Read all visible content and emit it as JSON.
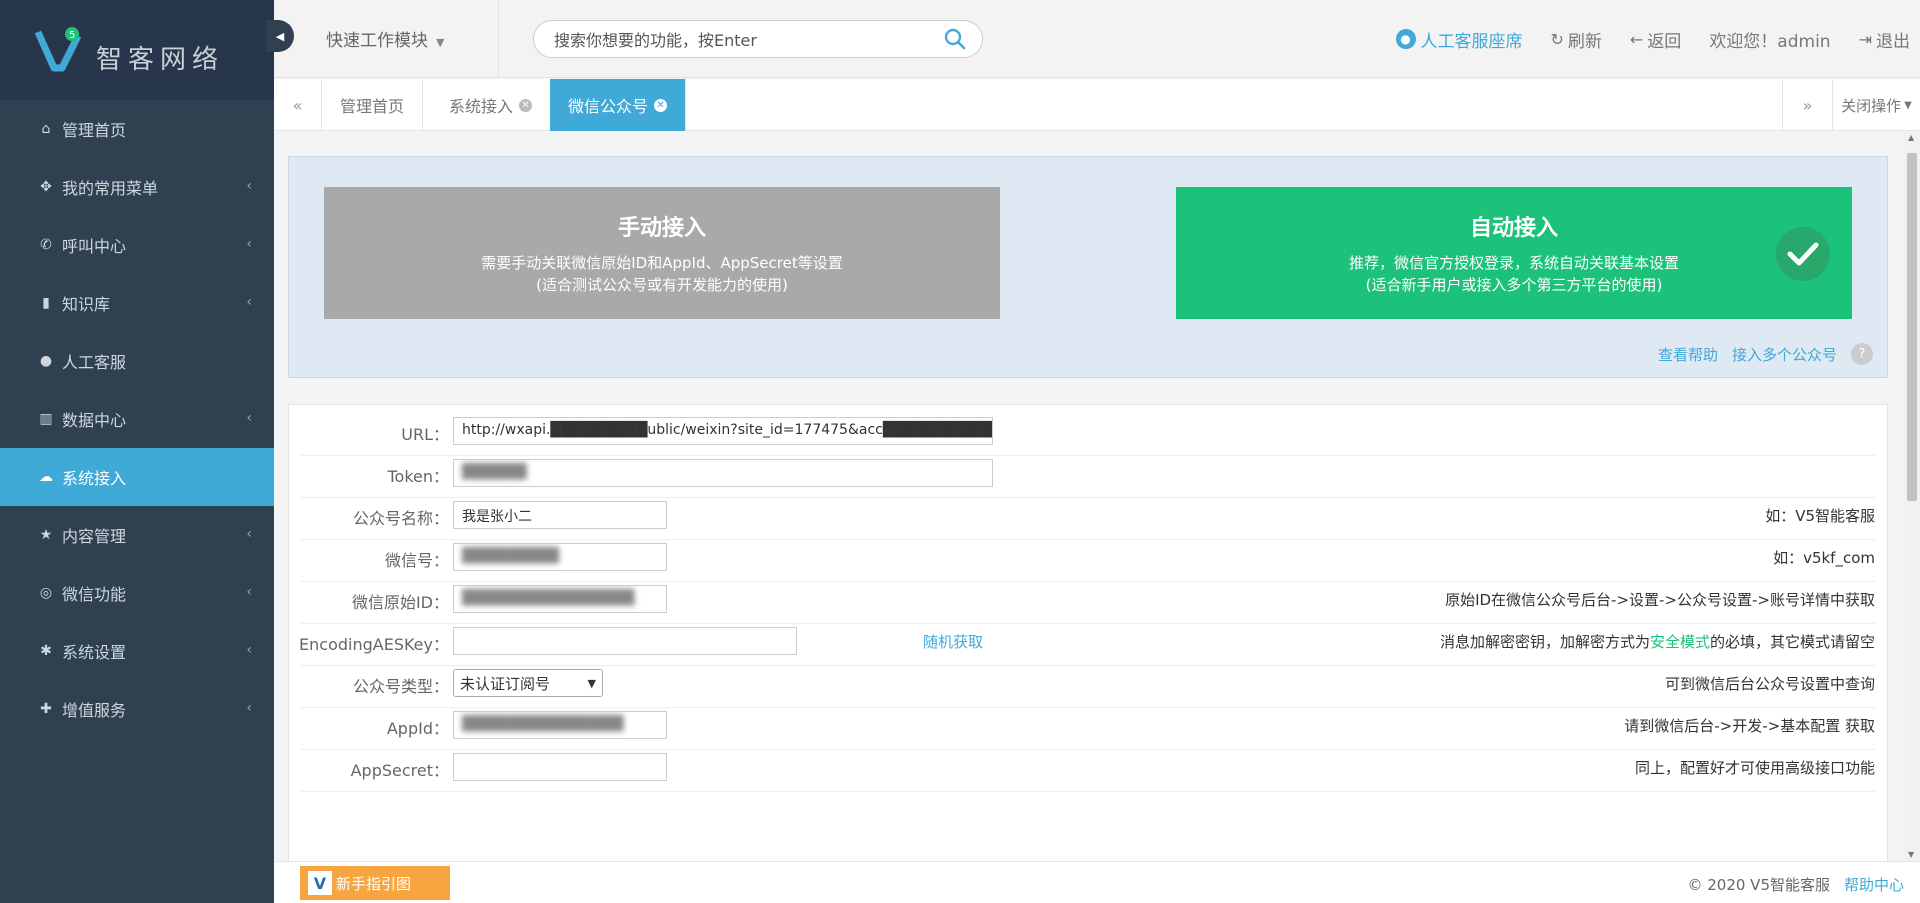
{
  "brand": {
    "logo_text": "智客网络"
  },
  "sidebar": {
    "items": [
      {
        "label": "管理首页",
        "icon": "home-icon",
        "glyph": "⌂",
        "has_submenu": false
      },
      {
        "label": "我的常用菜单",
        "icon": "grid-icon",
        "glyph": "✥",
        "has_submenu": true
      },
      {
        "label": "呼叫中心",
        "icon": "phone-icon",
        "glyph": "✆",
        "has_submenu": true
      },
      {
        "label": "知识库",
        "icon": "book-icon",
        "glyph": "▮",
        "has_submenu": true
      },
      {
        "label": "人工客服",
        "icon": "user-icon",
        "glyph": "●",
        "has_submenu": false
      },
      {
        "label": "数据中心",
        "icon": "bar-chart-icon",
        "glyph": "▥",
        "has_submenu": true
      },
      {
        "label": "系统接入",
        "icon": "cloud-icon",
        "glyph": "☁",
        "has_submenu": false,
        "active": true
      },
      {
        "label": "内容管理",
        "icon": "star-icon",
        "glyph": "★",
        "has_submenu": true
      },
      {
        "label": "微信功能",
        "icon": "wechat-icon",
        "glyph": "◎",
        "has_submenu": true
      },
      {
        "label": "系统设置",
        "icon": "gear-icon",
        "glyph": "✱",
        "has_submenu": true
      },
      {
        "label": "增值服务",
        "icon": "plus-icon",
        "glyph": "✚",
        "has_submenu": true
      }
    ]
  },
  "header": {
    "quick_module": "快速工作模块",
    "search_placeholder": "搜索你想要的功能，按Enter",
    "agent_seat": "人工客服座席",
    "refresh": "刷新",
    "back": "返回",
    "welcome": "欢迎您！admin",
    "logout": "退出"
  },
  "tabs": {
    "items": [
      {
        "label": "管理首页",
        "closable": false
      },
      {
        "label": "系统接入",
        "closable": true
      },
      {
        "label": "微信公众号",
        "closable": true,
        "active": true
      }
    ],
    "close_ops": "关闭操作"
  },
  "mode": {
    "manual": {
      "title": "手动接入",
      "desc1": "需要手动关联微信原始ID和AppId、AppSecret等设置",
      "desc2": "(适合测试公众号或有开发能力的使用)"
    },
    "auto": {
      "title": "自动接入",
      "desc1": "推荐，微信官方授权登录，系统自动关联基本设置",
      "desc2": "(适合新手用户或接入多个第三方平台的使用)"
    },
    "help_link": "查看帮助",
    "multi_link": "接入多个公众号",
    "question_mark": "?"
  },
  "form": {
    "url": {
      "label": "URL：",
      "value": "http://wxapi.█████████ublic/weixin?site_id=177475&acc████████████████"
    },
    "token": {
      "label": "Token：",
      "value": "██████"
    },
    "name": {
      "label": "公众号名称：",
      "value": "我是张小二",
      "note": "如：V5智能客服"
    },
    "wxid": {
      "label": "微信号：",
      "value": "█████████",
      "note": "如：v5kf_com"
    },
    "origin": {
      "label": "微信原始ID：",
      "value": "████████████████",
      "note": "原始ID在微信公众号后台->设置->公众号设置->账号详情中获取"
    },
    "aeskey": {
      "label": "EncodingAESKey：",
      "value": "",
      "link": "随机获取",
      "note_pre": "消息加解密密钥，加解密方式为",
      "note_green": "安全模式",
      "note_post": "的必填，其它模式请留空"
    },
    "type": {
      "label": "公众号类型：",
      "value": "未认证订阅号",
      "note": "可到微信后台公众号设置中查询"
    },
    "appid": {
      "label": "AppId：",
      "value": "███████████████",
      "note": "请到微信后台->开发->基本配置 获取"
    },
    "appsecret": {
      "label": "AppSecret：",
      "value": "",
      "note": "同上，配置好才可使用高级接口功能"
    }
  },
  "footer": {
    "guide": "新手指引图",
    "guide_badge": "V",
    "copyright": "© 2020 V5智能客服",
    "help_center": "帮助中心"
  },
  "colors": {
    "sidebar_bg": "#2f4050",
    "accent": "#3fa9d8",
    "green": "#1cc27a",
    "manual_gray": "#a9a9a9"
  }
}
